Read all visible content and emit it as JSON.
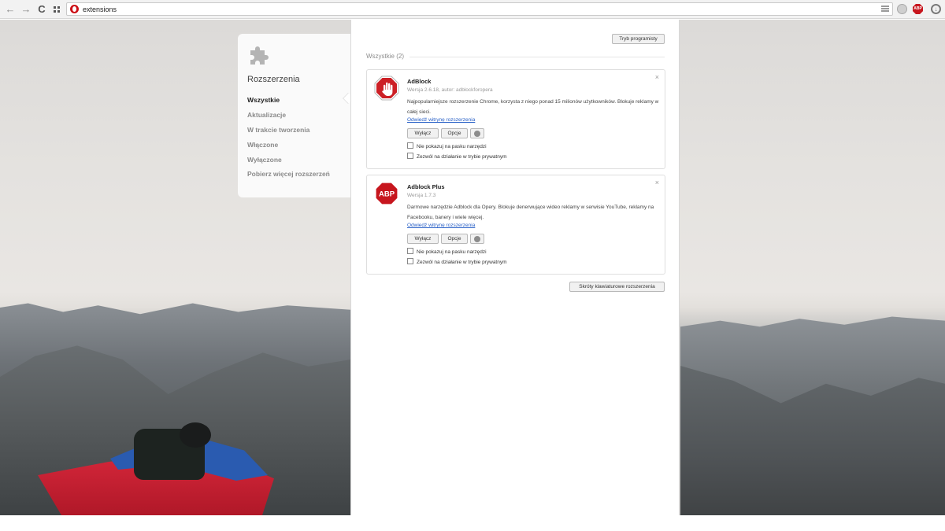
{
  "browser": {
    "url": "extensions",
    "back_icon": "arrow-left",
    "forward_icon": "arrow-right",
    "reload_icon": "reload",
    "speeddial_icon": "grid",
    "toolbar_extensions": [
      "ghost-extension",
      "adblock-plus",
      "download-status"
    ],
    "abp_badge": "ABP"
  },
  "sidebar": {
    "title": "Rozszerzenia",
    "items": [
      {
        "label": "Wszystkie",
        "active": true
      },
      {
        "label": "Aktualizacje",
        "active": false
      },
      {
        "label": "W trakcie tworzenia",
        "active": false
      },
      {
        "label": "Włączone",
        "active": false
      },
      {
        "label": "Wyłączone",
        "active": false
      },
      {
        "label": "Pobierz więcej rozszerzeń",
        "active": false
      }
    ]
  },
  "main": {
    "devmode_label": "Tryb programisty",
    "section_heading": "Wszystkie (2)",
    "shortcuts_label": "Skróty klawiaturowe rozszerzenia",
    "extensions": [
      {
        "name": "AdBlock",
        "version": "Wersja 2.6.18, autor: adblockforopera",
        "description": "Najpopularniejsze rozszerzenie Chrome, korzysta z niego ponad 15 milionów użytkowników. Blokuje reklamy w całej sieci.",
        "link": "Odwiedź witrynę rozszerzenia",
        "disable_label": "Wyłącz",
        "options_label": "Opcje",
        "hide_toolbar_label": "Nie pokazuj na pasku narzędzi",
        "private_label": "Zezwól na działanie w trybie prywatnym",
        "close": "×",
        "icon": "stop-hand-icon",
        "accent": "#cc1f25"
      },
      {
        "name": "Adblock Plus",
        "version": "Wersja 1.7.3",
        "description": "Darmowe narzędzie Adblock dla Opery. Blokuje denerwujące wideo reklamy w serwisie YouTube, reklamy na Facebooku, banery i wiele więcej.",
        "link": "Odwiedź witrynę rozszerzenia",
        "disable_label": "Wyłącz",
        "options_label": "Opcje",
        "hide_toolbar_label": "Nie pokazuj na pasku narzędzi",
        "private_label": "Zezwól na działanie w trybie prywatnym",
        "close": "×",
        "icon_text": "ABP",
        "accent": "#c7161e"
      }
    ]
  }
}
